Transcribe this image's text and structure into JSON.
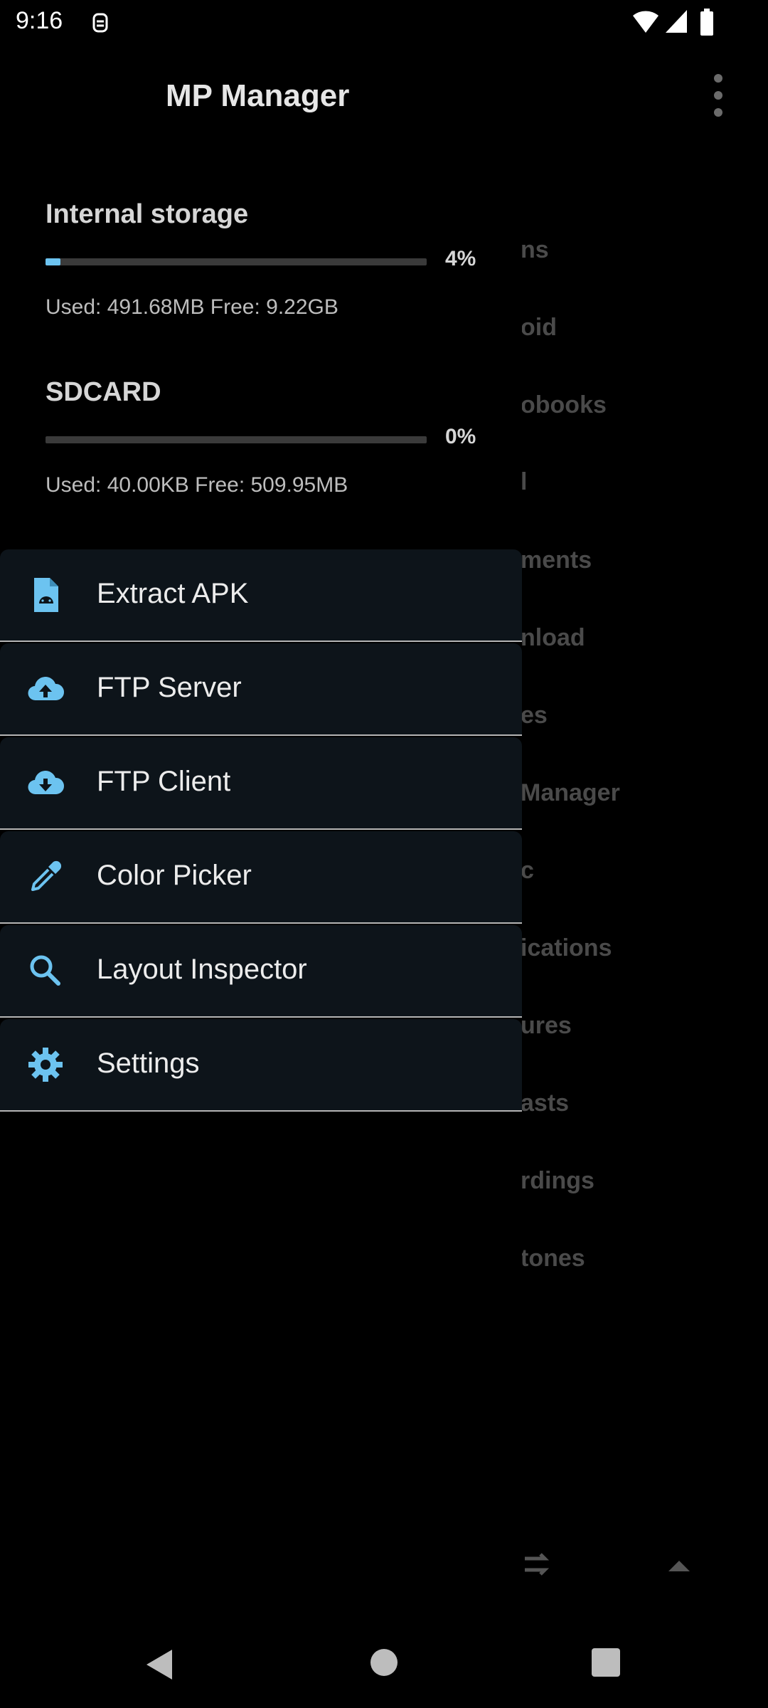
{
  "status_bar": {
    "time": "9:16"
  },
  "app": {
    "title": "MP Manager"
  },
  "storages": [
    {
      "name": "Internal storage",
      "percent_label": "4%",
      "percent": 4,
      "used_text": "Used: 491.68MB Free: 9.22GB"
    },
    {
      "name": "SDCARD",
      "percent_label": "0%",
      "percent": 0,
      "used_text": "Used: 40.00KB Free: 509.95MB"
    }
  ],
  "menu": [
    {
      "label": "Extract APK",
      "icon": "android-file-icon"
    },
    {
      "label": "FTP Server",
      "icon": "cloud-upload-icon"
    },
    {
      "label": "FTP Client",
      "icon": "cloud-download-icon"
    },
    {
      "label": "Color Picker",
      "icon": "eyedropper-icon"
    },
    {
      "label": "Layout Inspector",
      "icon": "search-icon"
    },
    {
      "label": "Settings",
      "icon": "gear-icon"
    }
  ],
  "background_items": [
    "ns",
    "oid",
    "obooks",
    "l",
    "ments",
    "nload",
    "es",
    "Manager",
    "c",
    "ications",
    "ures",
    "asts",
    "rdings",
    "tones"
  ],
  "colors": {
    "accent": "#6cc3f0",
    "menu_bg": "#0d141a",
    "background": "#000000"
  }
}
